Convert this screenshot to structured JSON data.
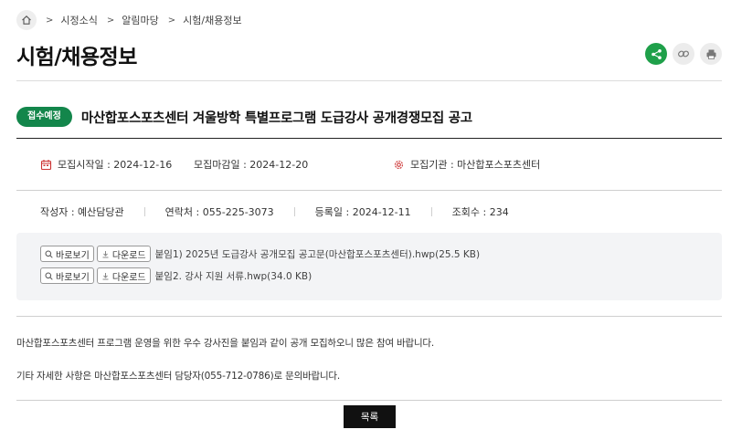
{
  "breadcrumb": {
    "items": [
      "시정소식",
      "알림마당",
      "시험/채용정보"
    ]
  },
  "page": {
    "title": "시험/채용정보"
  },
  "actions": {
    "share_color": "#1fa04a"
  },
  "post": {
    "badge": "접수예정",
    "title": "마산합포스포츠센터 겨울방학 특별프로그램 도급강사 공개경쟁모집 공고"
  },
  "info": {
    "start": "모집시작일 : 2024-12-16",
    "end": "모집마감일 : 2024-12-20",
    "org": "모집기관 : 마산합포스포츠센터"
  },
  "meta": {
    "author": "작성자 : 예산담당관",
    "contact": "연락처 : 055-225-3073",
    "registered": "등록일 : 2024-12-11",
    "views": "조회수 : 234"
  },
  "files": {
    "view_label": "바로보기",
    "download_label": "다운로드",
    "items": [
      "붙임1) 2025년 도급강사 공개모집 공고문(마산합포스포츠센터).hwp(25.5 KB)",
      "붙임2. 강사 지원 서류.hwp(34.0 KB)"
    ]
  },
  "content": {
    "p1": "마산합포스포츠센터 프로그램 운영을 위한 우수 강사진을 붙임과 같이 공개 모집하오니 많은 참여 바랍니다.",
    "p2": "기타 자세한 사항은 마산합포스포츠센터 담당자(055-712-0786)로 문의바랍니다."
  },
  "list_button": "목록",
  "colors": {
    "badge": "#13864b",
    "accent": "#1fa04a"
  }
}
